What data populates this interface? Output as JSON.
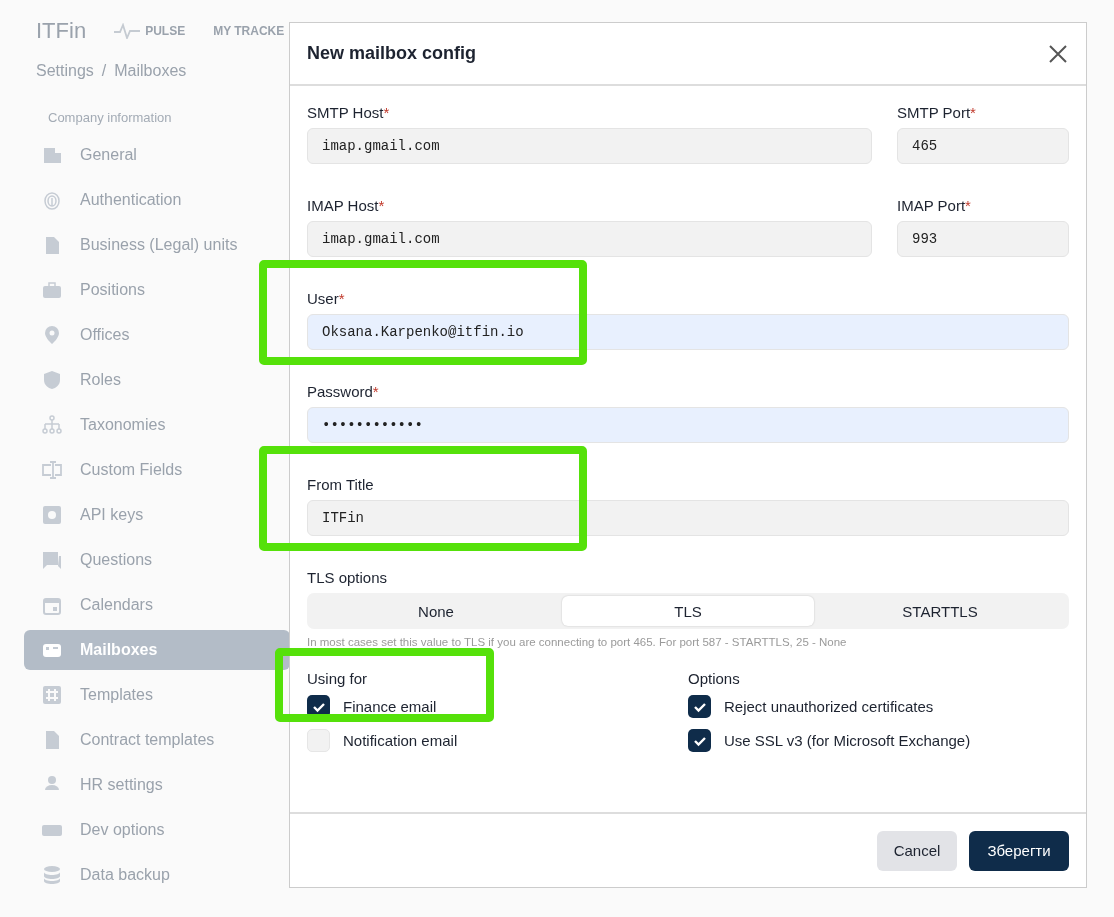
{
  "header": {
    "logo": "ITFin",
    "nav": [
      {
        "label": "PULSE",
        "kind": "pulse"
      },
      {
        "label": "MY TRACKE",
        "kind": "plain"
      }
    ]
  },
  "breadcrumb": [
    "Settings",
    "/",
    "Mailboxes"
  ],
  "sidebar": {
    "section": "Company information",
    "items": [
      {
        "label": "General",
        "selected": false
      },
      {
        "label": "Authentication",
        "selected": false
      },
      {
        "label": "Business (Legal) units",
        "selected": false
      },
      {
        "label": "Positions",
        "selected": false
      },
      {
        "label": "Offices",
        "selected": false
      },
      {
        "label": "Roles",
        "selected": false
      },
      {
        "label": "Taxonomies",
        "selected": false
      },
      {
        "label": "Custom Fields",
        "selected": false
      },
      {
        "label": "API keys",
        "selected": false
      },
      {
        "label": "Questions",
        "selected": false
      },
      {
        "label": "Calendars",
        "selected": false
      },
      {
        "label": "Mailboxes",
        "selected": true
      },
      {
        "label": "Templates",
        "selected": false
      },
      {
        "label": "Contract templates",
        "selected": false
      },
      {
        "label": "HR settings",
        "selected": false
      },
      {
        "label": "Dev options",
        "selected": false
      },
      {
        "label": "Data backup",
        "selected": false
      }
    ]
  },
  "dialog": {
    "title": "New mailbox config",
    "rows": [
      [
        {
          "label": "SMTP Host",
          "required_mark": "*",
          "value": "imap.gmail.com",
          "autofilled": false,
          "highlighted": false
        },
        {
          "label": "SMTP Port",
          "required_mark": "*",
          "value": "465",
          "autofilled": false,
          "highlighted": false
        }
      ],
      [
        {
          "label": "IMAP Host",
          "required_mark": "*",
          "value": "imap.gmail.com",
          "autofilled": false,
          "highlighted": false
        },
        {
          "label": "IMAP Port",
          "required_mark": "*",
          "value": "993",
          "autofilled": false,
          "highlighted": false
        }
      ],
      [
        {
          "label": "User",
          "required_mark": "*",
          "value": "Oksana.Karpenko@itfin.io",
          "autofilled": true,
          "highlighted": true
        }
      ],
      [
        {
          "label": "Password",
          "required_mark": "*",
          "value": "••••••••••••",
          "autofilled": true,
          "highlighted": false
        }
      ],
      [
        {
          "label": "From Title",
          "value": "ITFin",
          "autofilled": false,
          "highlighted": true
        }
      ]
    ],
    "tls": {
      "label": "TLS options",
      "options": [
        {
          "label": "None",
          "selected": false
        },
        {
          "label": "TLS",
          "selected": true
        },
        {
          "label": "STARTTLS",
          "selected": false
        }
      ],
      "hint": "In most cases set this value to TLS if you are connecting to port 465. For port 587 - STARTTLS, 25 - None"
    },
    "groups": [
      {
        "title": "Using for",
        "highlighted": true,
        "items": [
          {
            "label": "Finance email",
            "checked": true
          },
          {
            "label": "Notification email",
            "checked": false
          }
        ]
      },
      {
        "title": "Options",
        "highlighted": false,
        "items": [
          {
            "label": "Reject unauthorized certificates",
            "checked": true
          },
          {
            "label": "Use SSL v3 (for Microsoft Exchange)",
            "checked": true
          }
        ]
      }
    ],
    "buttons": [
      {
        "label": "Cancel",
        "kind": "secondary"
      },
      {
        "label": "Зберегти",
        "kind": "primary"
      }
    ]
  }
}
